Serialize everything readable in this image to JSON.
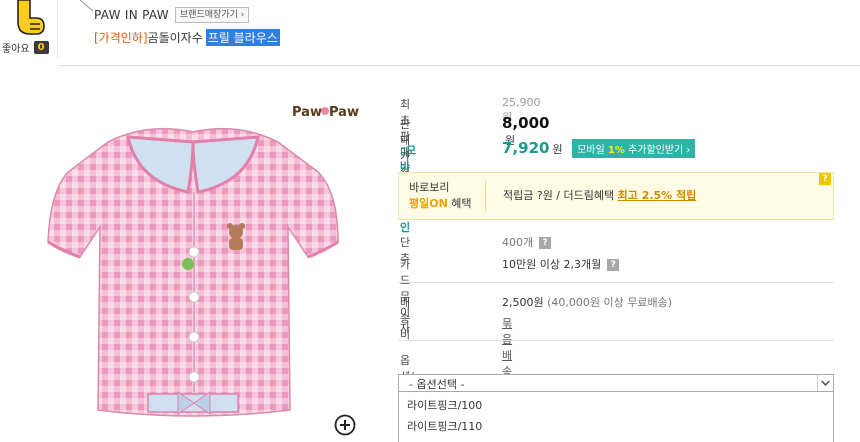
{
  "like": {
    "label": "좋아요",
    "count": "0"
  },
  "header": {
    "brand": "PAW IN PAW",
    "brand_shop": "브랜드매장가기",
    "title_tag": "[가격인하]",
    "title_plain": "곰돌이자수",
    "title_highlight": "프릴 블라우스"
  },
  "product_image": {
    "logo_text": "Paw❦Paw"
  },
  "info": {
    "lowest_price_label": "최초판매가격",
    "lowest_price": "25,900 원",
    "sale_label": "판매가격",
    "sale_price": "8,000",
    "won": "원",
    "mobile_label": "모바일1%할인",
    "mobile_price": "7,920",
    "mobile_btn_pre": "모바일",
    "mobile_btn_hl": "1%",
    "mobile_btn_post": "추가할인받기 ›",
    "benefit_line1": "바로보리",
    "benefit_on": "평일ON",
    "benefit_on_suffix": " 혜택",
    "benefit_text": "적립금 ?원 / 더드림혜택 ",
    "benefit_link": "최고 2.5% 적립",
    "benefit_q": "?",
    "unit_label": "단추",
    "unit_value": "400개",
    "card_label": "카드무이자",
    "card_value": "10만원 이상 2,3개월",
    "ship_label": "배송비",
    "ship_value": "2,500원",
    "ship_note": "(40,000원 이상 무료배송)",
    "bundle_link": "묶음배송브랜드 ›",
    "option_label": "옵션/수량선택",
    "option_placeholder": "- 옵션선택 -",
    "options": [
      "라이트핑크/100",
      "라이트핑크/110"
    ]
  },
  "colors": {
    "accent_teal": "#2fb3a7",
    "highlight_blue": "#2f7ee2",
    "tag_orange": "#e65a00"
  }
}
